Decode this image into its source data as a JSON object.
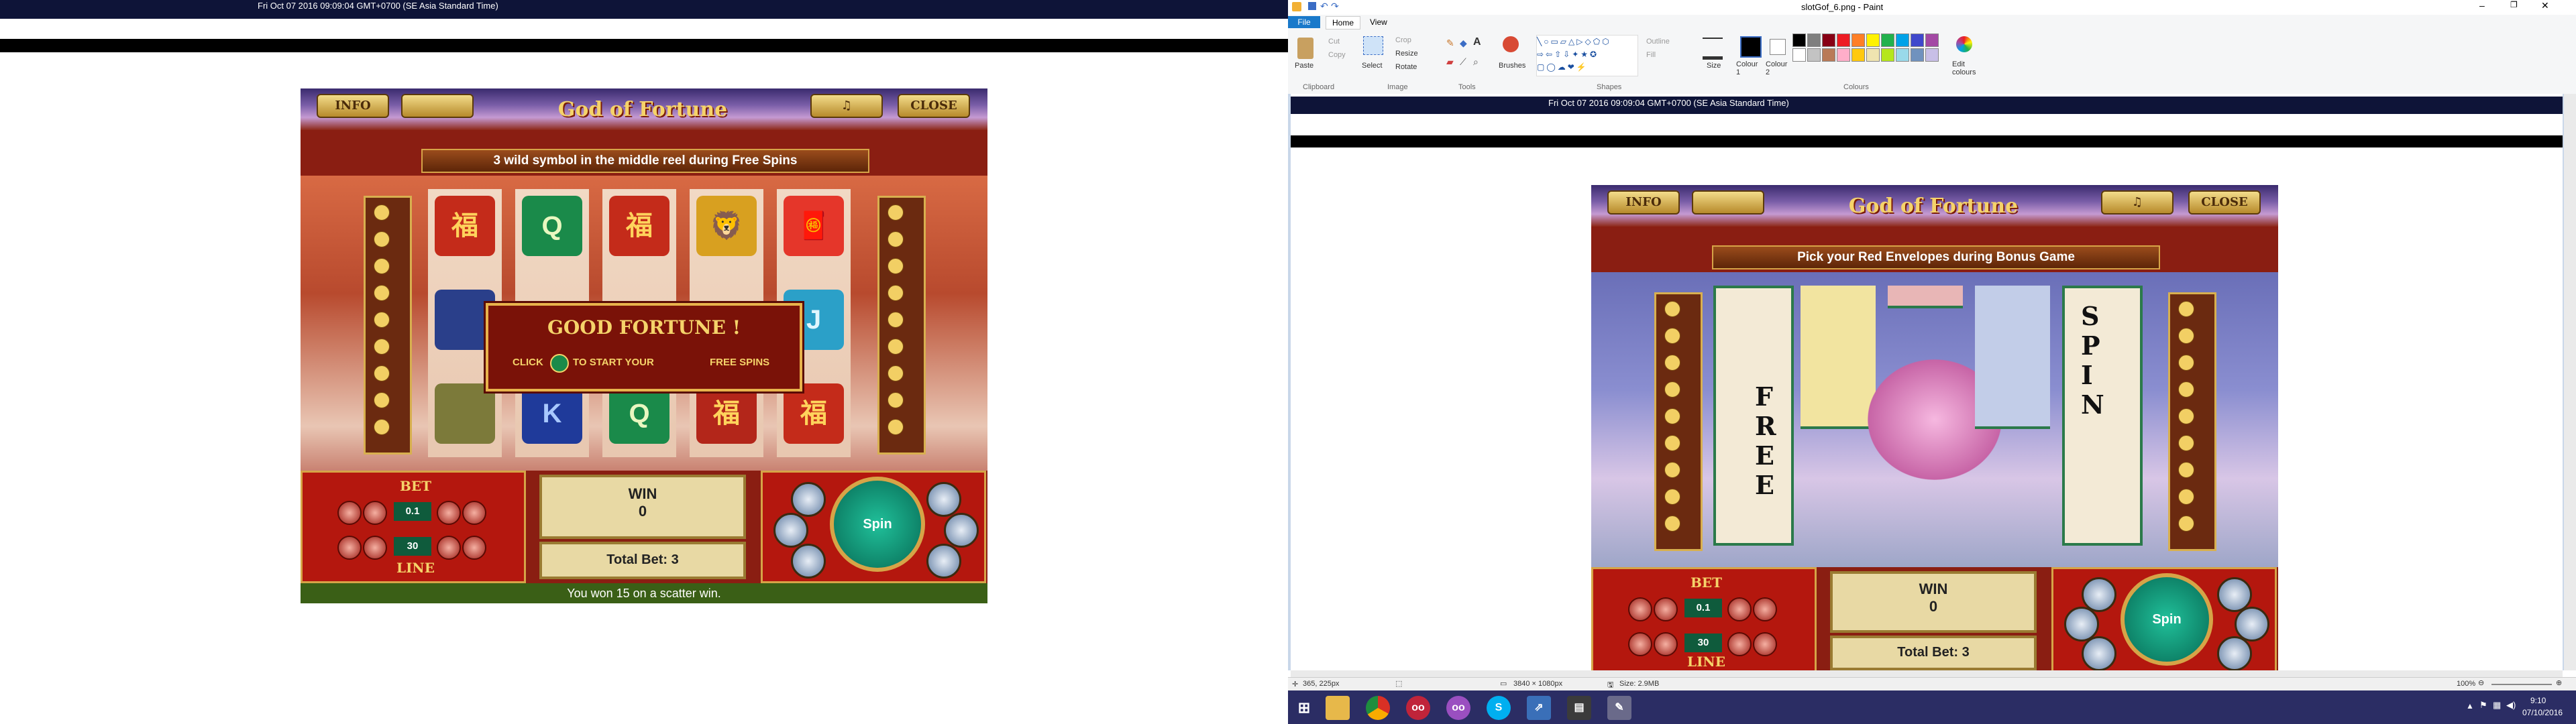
{
  "left_screen": {
    "timestamp": "Fri Oct 07 2016 09:09:04 GMT+0700 (SE Asia Standard Time)"
  },
  "game_left": {
    "top_buttons": {
      "info": "INFO",
      "sound": "♫",
      "close": "CLOSE"
    },
    "logo": "God of Fortune",
    "banner": "3 wild symbol in the middle reel during Free Spins",
    "popup": {
      "title": "GOOD FORTUNE !",
      "click": "CLICK",
      "to_start": "TO START YOUR",
      "free_spins": "FREE SPINS"
    },
    "bet": {
      "bet_label": "BET",
      "line_label": "LINE",
      "bet_value": "0.1",
      "line_value": "30"
    },
    "win": {
      "label": "WIN",
      "value": "0"
    },
    "total_bet": "Total Bet: 3",
    "spin": "Spin",
    "message": "You won 15 on a scatter win.",
    "reel_symbols": [
      "福",
      "Q",
      "福",
      "🦁",
      "🧧",
      "J",
      "K",
      "Q",
      "福",
      "福"
    ]
  },
  "paint": {
    "title": "slotGof_6.png - Paint",
    "tabs": {
      "file": "File",
      "home": "Home",
      "view": "View"
    },
    "ribbon": {
      "paste": "Paste",
      "cut": "Cut",
      "copy": "Copy",
      "select": "Select",
      "crop": "Crop",
      "resize": "Resize",
      "rotate": "Rotate",
      "brushes": "Brushes",
      "outline": "Outline",
      "fill": "Fill",
      "size": "Size",
      "colour1": "Colour 1",
      "colour2": "Colour 2",
      "edit_colours": "Edit colours",
      "groups": {
        "clipboard": "Clipboard",
        "image": "Image",
        "tools": "Tools",
        "shapes": "Shapes",
        "colours": "Colours"
      }
    },
    "palette": [
      "#000000",
      "#7f7f7f",
      "#880015",
      "#ed1c24",
      "#ff7f27",
      "#fff200",
      "#22b14c",
      "#00a2e8",
      "#3f48cc",
      "#a349a4",
      "#ffffff",
      "#c3c3c3",
      "#b97a57",
      "#ffaec9",
      "#ffc90e",
      "#efe4b0",
      "#b5e61d",
      "#99d9ea",
      "#7092be",
      "#c8bfe7"
    ],
    "canvas_timestamp": "Fri Oct 07 2016 09:09:04 GMT+0700 (SE Asia Standard Time)",
    "status": {
      "cursor": "365, 225px",
      "dimensions": "3840 × 1080px",
      "size": "Size: 2.9MB",
      "zoom": "100%"
    }
  },
  "game_right": {
    "top_buttons": {
      "info": "INFO",
      "sound": "♫",
      "close": "CLOSE"
    },
    "logo": "God of Fortune",
    "banner": "Pick your Red Envelopes during Bonus Game",
    "scroll_left": "FREE",
    "scroll_right": "SPIN",
    "bet": {
      "bet_label": "BET",
      "line_label": "LINE",
      "bet_value": "0.1",
      "line_value": "30"
    },
    "win": {
      "label": "WIN",
      "value": "0"
    },
    "total_bet": "Total Bet: 3",
    "spin": "Spin"
  },
  "taskbar": {
    "time": "9:10",
    "date": "07/10/2016"
  }
}
